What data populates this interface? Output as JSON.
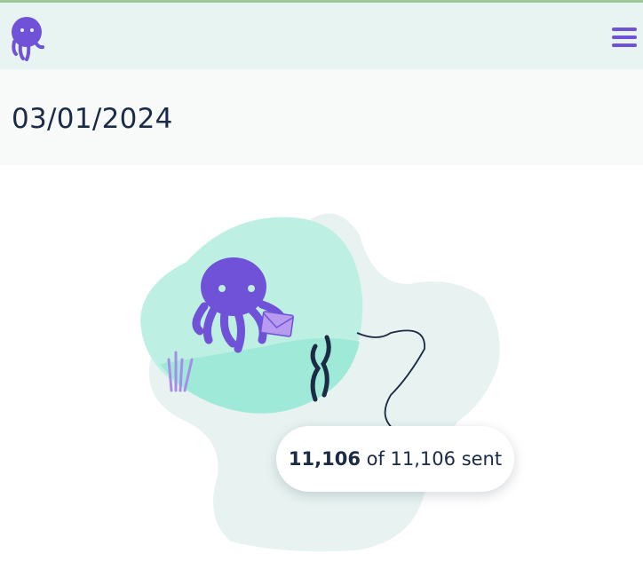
{
  "header": {
    "logo_icon": "octopus-logo-icon",
    "menu_icon": "hamburger-menu-icon"
  },
  "subheader": {
    "date": "03/01/2024"
  },
  "progress": {
    "sent_count": "11,106",
    "of_label": " of ",
    "total": "11,106",
    "sent_label": " sent"
  },
  "colors": {
    "brand_purple": "#6f52d7",
    "header_bg": "#e7f4f1",
    "text_dark": "#1b2a45"
  }
}
